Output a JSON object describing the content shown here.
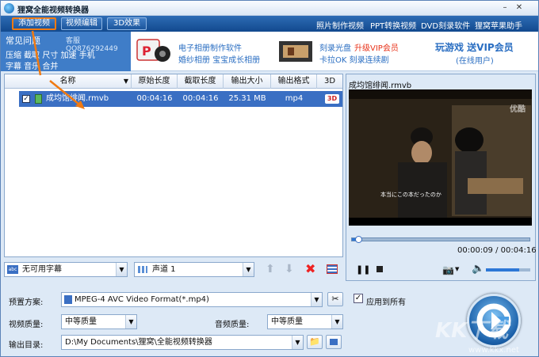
{
  "window": {
    "title": "狸窝全能视频转换器"
  },
  "menubar": {
    "add_video": "添加视频",
    "edit_video": "视频编辑",
    "effect_3d": "3D效果",
    "links": [
      "照片制作视频",
      "PPT转换视频",
      "DVD刻录软件",
      "狸窝苹果助手"
    ]
  },
  "banner": {
    "tips_title": "常见问题",
    "tips_qq": "客服QQ876292449",
    "tips_line1": "压缩 截取 尺寸 加速 手机",
    "tips_line2": "字幕 音乐 合并",
    "ad1_line1": "电子相册制作软件",
    "ad1_line2": "婚纱相册 宝宝成长相册",
    "ad2_line1_a": "刻录光盘",
    "ad2_line1_b": "升级VIP会员",
    "ad2_line2": "卡拉OK 刻录连续剧",
    "ad3_line1": "玩游戏 送VIP会员",
    "ad3_line2": "(在线用户)"
  },
  "file_list": {
    "columns": [
      "名称",
      "原始长度",
      "截取长度",
      "输出大小",
      "输出格式",
      "3D"
    ],
    "rows": [
      {
        "name": "成均馆绯闻.rmvb",
        "original_length": "00:04:16",
        "cut_length": "00:04:16",
        "output_size": "25.31 MB",
        "output_format": "mp4",
        "mode_3d": "3D",
        "checked": true
      }
    ]
  },
  "list_tools": {
    "subtitle": "无可用字幕",
    "audio_track": "声道 1"
  },
  "preview": {
    "title": "成均馆绯闻.rmvb",
    "watermark": "优酷",
    "subtitle": "本当にこの本だったのか",
    "current_time": "00:00:09",
    "total_time": "00:04:16",
    "progress": 0.035,
    "volume": 0.75
  },
  "settings": {
    "preset_label": "预置方案:",
    "preset_value": "MPEG-4 AVC Video Format(*.mp4)",
    "apply_all_label": "应用到所有",
    "apply_all_checked": true,
    "video_quality_label": "视频质量:",
    "video_quality_value": "中等质量",
    "audio_quality_label": "音频质量:",
    "audio_quality_value": "中等质量",
    "output_dir_label": "输出目录:",
    "output_dir_value": "D:\\My Documents\\狸窝\\全能视频转换器"
  },
  "watermark": {
    "text": "KK下载",
    "url": "www.kkx.net"
  },
  "colors": {
    "accent": "#1b559c",
    "selection": "#3a6fc3",
    "highlight_orange": "#f07a12",
    "vip_red": "#e8331a"
  }
}
